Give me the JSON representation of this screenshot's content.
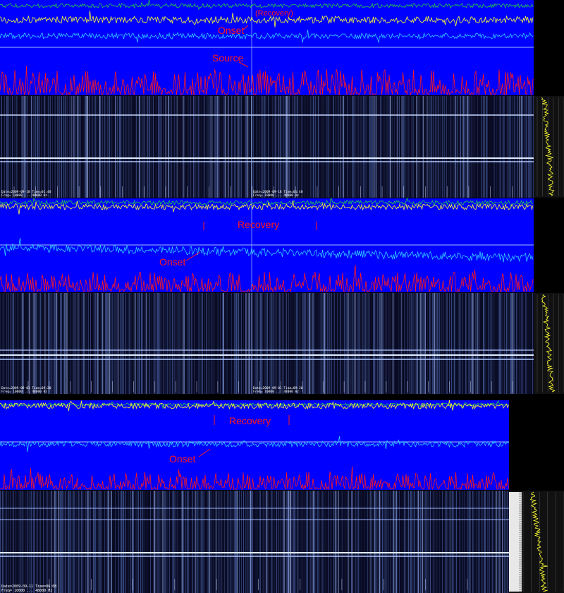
{
  "colors": {
    "panel_blue": "#0000ff",
    "spectrogram_bg": "#05051a",
    "annotation": "#ff1a1a",
    "trace_green": "#22cc44",
    "trace_yellow": "#ffff33",
    "trace_cyan": "#33ccff",
    "trace_red": "#ff1a1a"
  },
  "panels": [
    {
      "annotations": {
        "recovery": "(Recovery)",
        "onset": "Onset",
        "source": "Source"
      },
      "info": {
        "line1": "Date=2009-09-18 Time=01:40",
        "line2": "Freq= 10000 ... 48000 Hz",
        "line3": "Date=2009-09-18 Time=01:40",
        "line4": "Freq= 10000 ... 48000 Hz"
      }
    },
    {
      "annotations": {
        "recovery": "Recovery",
        "onset": "Onset"
      },
      "info": {
        "line1": "Date=2009-09-01 Time=09:20",
        "line2": "Freq= 10000 ... 48000 Hz",
        "line3": "Date=2009-09-01 Time=09:20",
        "line4": "Freq= 10000 ... 48000 Hz"
      }
    },
    {
      "annotations": {
        "recovery": "Recovery",
        "onset": "Onset"
      },
      "info": {
        "line1": "Date=2009-09-11 Time=06:08",
        "line2": "Freq= 10000 ... 48000 Hz"
      }
    }
  ]
}
